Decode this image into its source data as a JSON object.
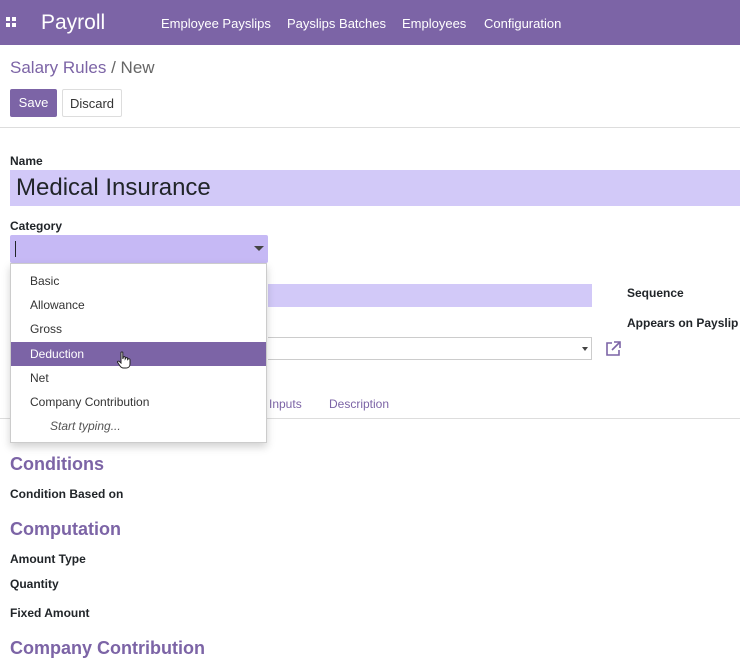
{
  "topbar": {
    "app_title": "Payroll",
    "menu": [
      "Employee Payslips",
      "Payslips Batches",
      "Employees",
      "Configuration"
    ]
  },
  "breadcrumb": {
    "parent": "Salary Rules",
    "separator": " / ",
    "current": "New"
  },
  "buttons": {
    "save": "Save",
    "discard": "Discard"
  },
  "form": {
    "name_label": "Name",
    "name_value": "Medical Insurance",
    "category_label": "Category",
    "category_value": "",
    "sequence_label": "Sequence",
    "appears_label": "Appears on Payslip"
  },
  "category_dropdown": {
    "options": [
      "Basic",
      "Allowance",
      "Gross",
      "Deduction",
      "Net",
      "Company Contribution"
    ],
    "highlighted": "Deduction",
    "hint": "Start typing..."
  },
  "tabs": [
    "Inputs",
    "Description"
  ],
  "sections": {
    "conditions_title": "Conditions",
    "condition_based_on_label": "Condition Based on",
    "computation_title": "Computation",
    "amount_type_label": "Amount Type",
    "quantity_label": "Quantity",
    "fixed_amount_label": "Fixed Amount",
    "company_contribution_title": "Company Contribution"
  },
  "colors": {
    "brand": "#7c64a6",
    "required_field": "#d2c9f8"
  }
}
